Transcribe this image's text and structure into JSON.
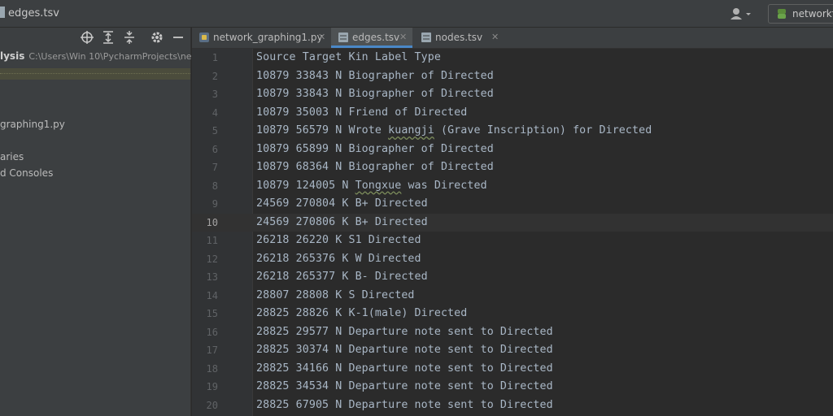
{
  "window": {
    "title": "edges.tsv",
    "run_config": "networkfu"
  },
  "sidebar": {
    "project_name": "lysis",
    "project_path": "C:\\Users\\Win 10\\PycharmProjects\\ne",
    "items": [
      {
        "label": "graphing1.py"
      },
      {
        "label": "aries"
      },
      {
        "label": "d Consoles"
      }
    ]
  },
  "tabs": [
    {
      "label": "network_graphing1.py",
      "icon": "python-file-icon",
      "active": false
    },
    {
      "label": "edges.tsv",
      "icon": "tsv-file-icon",
      "active": true
    },
    {
      "label": "nodes.tsv",
      "icon": "tsv-file-icon",
      "active": false
    }
  ],
  "editor": {
    "current_line": 10,
    "lines": [
      {
        "num": "1",
        "text": "Source Target Kin Label Type"
      },
      {
        "num": "2",
        "text": "10879 33843 N Biographer of Directed"
      },
      {
        "num": "3",
        "text": "10879 33843 N Biographer of Directed"
      },
      {
        "num": "4",
        "text": "10879 35003 N Friend of Directed"
      },
      {
        "num": "5",
        "pre": "10879 56579 N Wrote ",
        "squig": "kuangji",
        "post": " (Grave Inscription) for Directed"
      },
      {
        "num": "6",
        "text": "10879 65899 N Biographer of Directed"
      },
      {
        "num": "7",
        "text": "10879 68364 N Biographer of Directed"
      },
      {
        "num": "8",
        "pre": "10879 124005 N ",
        "squig": "Tongxue",
        "post": " was Directed"
      },
      {
        "num": "9",
        "text": "24569 270804 K B+ Directed"
      },
      {
        "num": "10",
        "text": "24569 270806 K B+ Directed"
      },
      {
        "num": "11",
        "text": "26218 26220 K S1 Directed"
      },
      {
        "num": "12",
        "text": "26218 265376 K W Directed"
      },
      {
        "num": "13",
        "text": "26218 265377 K B- Directed"
      },
      {
        "num": "14",
        "text": "28807 28808 K S Directed"
      },
      {
        "num": "15",
        "text": "28825 28826 K K-1(male) Directed"
      },
      {
        "num": "16",
        "text": "28825 29577 N Departure note sent to Directed"
      },
      {
        "num": "17",
        "text": "28825 30374 N Departure note sent to Directed"
      },
      {
        "num": "18",
        "text": "28825 34166 N Departure note sent to Directed"
      },
      {
        "num": "19",
        "text": "28825 34534 N Departure note sent to Directed"
      },
      {
        "num": "20",
        "text": "28825 67905 N Departure note sent to Directed"
      }
    ]
  },
  "colors": {
    "editor_bg": "#2b2b2b",
    "panel_bg": "#3c3f41",
    "active_tab_underline": "#4a88c7",
    "code_text": "#a9b7c6"
  }
}
